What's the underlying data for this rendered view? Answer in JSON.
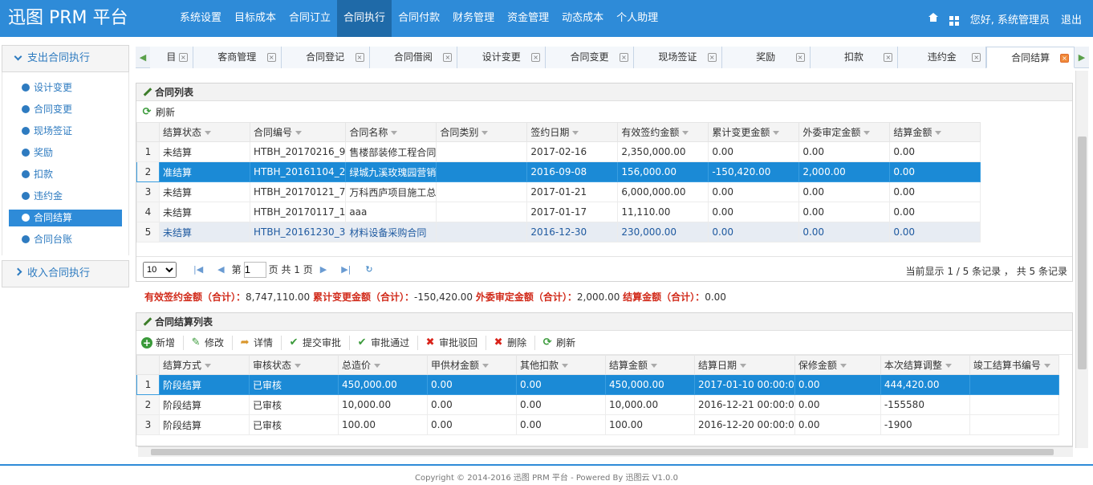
{
  "app": {
    "title": "迅图 PRM 平台"
  },
  "nav": [
    {
      "label": "系统设置"
    },
    {
      "label": "目标成本"
    },
    {
      "label": "合同订立"
    },
    {
      "label": "合同执行"
    },
    {
      "label": "合同付款"
    },
    {
      "label": "财务管理"
    },
    {
      "label": "资金管理"
    },
    {
      "label": "动态成本"
    },
    {
      "label": "个人助理"
    }
  ],
  "user": {
    "greeting": "您好, 系统管理员",
    "logout": "退出"
  },
  "sidebar": {
    "group1": "支出合同执行",
    "items": [
      {
        "label": "设计变更"
      },
      {
        "label": "合同变更"
      },
      {
        "label": "现场签证"
      },
      {
        "label": "奖励"
      },
      {
        "label": "扣款"
      },
      {
        "label": "违约金"
      },
      {
        "label": "合同结算"
      },
      {
        "label": "合同台账"
      }
    ],
    "group2": "收入合同执行"
  },
  "tabs": [
    {
      "label": "目"
    },
    {
      "label": "客商管理"
    },
    {
      "label": "合同登记"
    },
    {
      "label": "合同借阅"
    },
    {
      "label": "设计变更"
    },
    {
      "label": "合同变更"
    },
    {
      "label": "现场签证"
    },
    {
      "label": "奖励"
    },
    {
      "label": "扣款"
    },
    {
      "label": "违约金"
    },
    {
      "label": "合同结算"
    }
  ],
  "contracts": {
    "title": "合同列表",
    "refresh": "刷新",
    "columns": [
      "结算状态",
      "合同编号",
      "合同名称",
      "合同类别",
      "签约日期",
      "有效签约金额",
      "累计变更金额",
      "外委审定金额",
      "结算金额"
    ],
    "rows": [
      {
        "n": "1",
        "status": "未结算",
        "code": "HTBH_20170216_9",
        "name": "售楼部装修工程合同",
        "type": "",
        "date": "2017-02-16",
        "amount": "2,350,000.00",
        "change": "0.00",
        "audit": "0.00",
        "settle": "0.00"
      },
      {
        "n": "2",
        "status": "准结算",
        "code": "HTBH_20161104_2",
        "name": "绿城九溪玫瑰园营销",
        "type": "",
        "date": "2016-09-08",
        "amount": "156,000.00",
        "change": "-150,420.00",
        "audit": "2,000.00",
        "settle": "0.00"
      },
      {
        "n": "3",
        "status": "未结算",
        "code": "HTBH_20170121_7",
        "name": "万科西庐项目施工总",
        "type": "",
        "date": "2017-01-21",
        "amount": "6,000,000.00",
        "change": "0.00",
        "audit": "0.00",
        "settle": "0.00"
      },
      {
        "n": "4",
        "status": "未结算",
        "code": "HTBH_20170117_1",
        "name": "aaa",
        "type": "",
        "date": "2017-01-17",
        "amount": "11,110.00",
        "change": "0.00",
        "audit": "0.00",
        "settle": "0.00"
      },
      {
        "n": "5",
        "status": "未结算",
        "code": "HTBH_20161230_3",
        "name": "材料设备采购合同",
        "type": "",
        "date": "2016-12-30",
        "amount": "230,000.00",
        "change": "0.00",
        "audit": "0.00",
        "settle": "0.00"
      }
    ],
    "pager": {
      "page_size": "10",
      "page_label": "第",
      "page": "1",
      "page_total": "页 共 1 页",
      "info": "当前显示 1 / 5 条记录 ， 共 5 条记录"
    }
  },
  "summary": {
    "l1": "有效签约金额（合计）：",
    "v1": "8,747,110.00",
    "l2": "累计变更金额（合计）：",
    "v2": "-150,420.00",
    "l3": "外委审定金额（合计）：",
    "v3": "2,000.00",
    "l4": "结算金额（合计）：",
    "v4": "0.00"
  },
  "settlements": {
    "title": "合同结算列表",
    "toolbar": {
      "add": "新增",
      "edit": "修改",
      "detail": "详情",
      "submit": "提交审批",
      "approve": "审批通过",
      "reject": "审批驳回",
      "delete": "删除",
      "refresh": "刷新"
    },
    "columns": [
      "结算方式",
      "审核状态",
      "总造价",
      "甲供材金额",
      "其他扣款",
      "结算金额",
      "结算日期",
      "保修金额",
      "本次结算调整",
      "竣工结算书编号"
    ],
    "rows": [
      {
        "n": "1",
        "mode": "阶段结算",
        "state": "已审核",
        "total": "450,000.00",
        "supply": "0.00",
        "other": "0.00",
        "settle": "450,000.00",
        "date": "2017-01-10 00:00:0",
        "warranty": "0.00",
        "adjust": "444,420.00",
        "book": ""
      },
      {
        "n": "2",
        "mode": "阶段结算",
        "state": "已审核",
        "total": "10,000.00",
        "supply": "0.00",
        "other": "0.00",
        "settle": "10,000.00",
        "date": "2016-12-21 00:00:0",
        "warranty": "0.00",
        "adjust": "-155580",
        "book": ""
      },
      {
        "n": "3",
        "mode": "阶段结算",
        "state": "已审核",
        "total": "100.00",
        "supply": "0.00",
        "other": "0.00",
        "settle": "100.00",
        "date": "2016-12-20 00:00:0",
        "warranty": "0.00",
        "adjust": "-1900",
        "book": ""
      }
    ]
  },
  "footer": "Copyright © 2014-2016 迅图 PRM 平台 - Powered By 迅图云 V1.0.0"
}
